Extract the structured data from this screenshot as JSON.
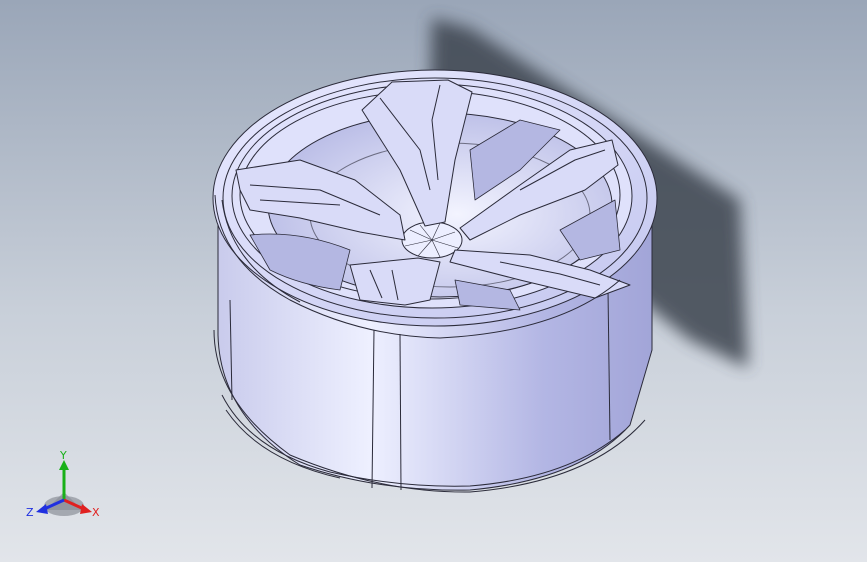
{
  "viewport": {
    "background_top": "#9aa6b8",
    "background_bottom": "#e2e5ea",
    "model": {
      "kind": "3D wheel rim model (shaded with edges)",
      "face_color": "#d6d8f2",
      "edge_color": "#2b2b3a",
      "shadow_color": "#3e4450",
      "spoke_count": 5
    }
  },
  "triad": {
    "x_label": "X",
    "y_label": "Y",
    "z_label": "Z",
    "x_color": "#e02020",
    "y_color": "#18b018",
    "z_color": "#2030e0"
  }
}
